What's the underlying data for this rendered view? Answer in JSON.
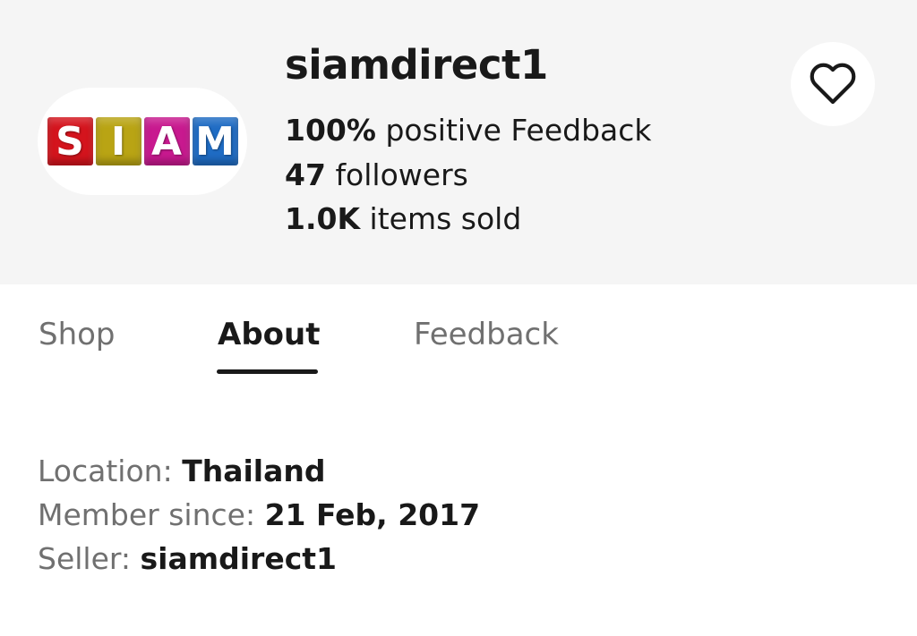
{
  "store": {
    "logo_letters": [
      {
        "letter": "S",
        "color": "#d4141d"
      },
      {
        "letter": "I",
        "color": "#b9a414"
      },
      {
        "letter": "A",
        "color": "#c8198f"
      },
      {
        "letter": "M",
        "color": "#1f6cc4"
      }
    ],
    "name": "siamdirect1",
    "stats": [
      {
        "value": "100%",
        "label": "positive Feedback"
      },
      {
        "value": "47",
        "label": "followers"
      },
      {
        "value": "1.0K",
        "label": "items sold"
      }
    ],
    "follow_icon": "heart-outline-icon"
  },
  "tabs": [
    {
      "label": "Shop",
      "active": false
    },
    {
      "label": "About",
      "active": true
    },
    {
      "label": "Feedback",
      "active": false
    }
  ],
  "about": {
    "location_label": "Location: ",
    "location_value": "Thailand",
    "member_label": "Member since: ",
    "member_value": "21 Feb, 2017",
    "seller_label": "Seller: ",
    "seller_value": "siamdirect1"
  }
}
